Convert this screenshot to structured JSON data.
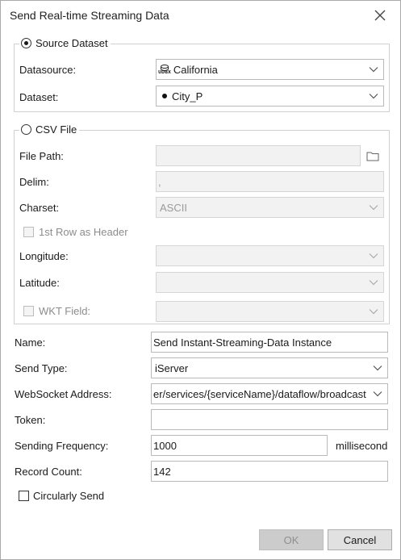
{
  "window": {
    "title": "Send Real-time Streaming Data"
  },
  "source_dataset": {
    "label": "Source Dataset",
    "selected": true,
    "datasource_label": "Datasource:",
    "datasource_value": "California",
    "datasource_icon_text": "UDBX",
    "dataset_label": "Dataset:",
    "dataset_value": "City_P"
  },
  "csv_file": {
    "label": "CSV File",
    "selected": false,
    "file_path_label": "File Path:",
    "file_path_value": "",
    "delim_label": "Delim:",
    "delim_value": ",",
    "charset_label": "Charset:",
    "charset_value": "ASCII",
    "first_row_header_label": "1st Row as Header",
    "longitude_label": "Longitude:",
    "longitude_value": "",
    "latitude_label": "Latitude:",
    "latitude_value": "",
    "wkt_field_label": "WKT Field:",
    "wkt_field_value": ""
  },
  "settings": {
    "name_label": "Name:",
    "name_value": "Send Instant-Streaming-Data Instance",
    "send_type_label": "Send Type:",
    "send_type_value": "iServer",
    "websocket_label": "WebSocket Address:",
    "websocket_value": "er/services/{serviceName}/dataflow/broadcast",
    "token_label": "Token:",
    "token_value": "",
    "frequency_label": "Sending Frequency:",
    "frequency_value": "1000",
    "frequency_unit": "millisecond",
    "record_count_label": "Record Count:",
    "record_count_value": "142",
    "circularly_send_label": "Circularly Send",
    "circularly_send_checked": false
  },
  "buttons": {
    "ok": "OK",
    "cancel": "Cancel"
  }
}
